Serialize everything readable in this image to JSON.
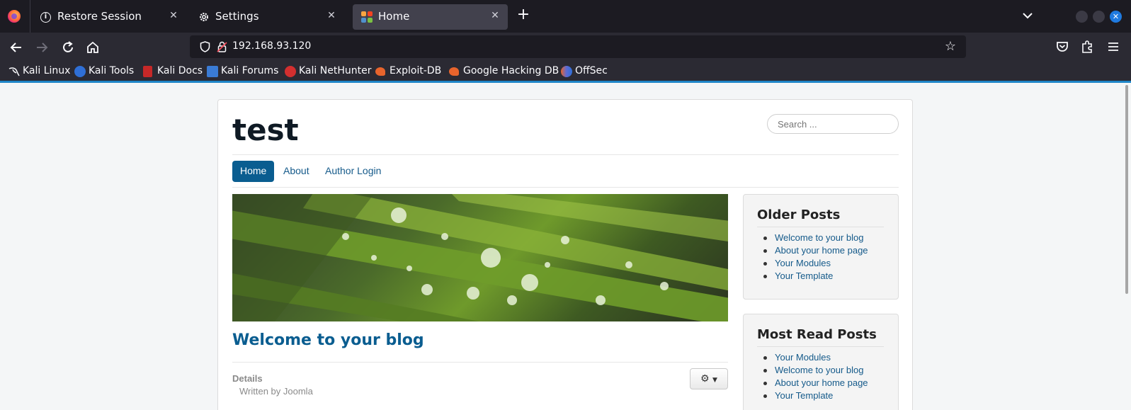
{
  "browser": {
    "tabs": [
      {
        "title": "Restore Session",
        "icon": "info-icon",
        "active": false
      },
      {
        "title": "Settings",
        "icon": "gear-icon",
        "active": false
      },
      {
        "title": "Home",
        "icon": "joomla-icon",
        "active": true
      }
    ],
    "new_tab_glyph": "+",
    "close_glyph": "✕",
    "url": "192.168.93.120",
    "bookmarks": [
      {
        "label": "Kali Linux",
        "icon": "kali-dragon-icon",
        "color": "#1c1b22"
      },
      {
        "label": "Kali Tools",
        "icon": "kali-tools-icon",
        "color": "#2f6fd6"
      },
      {
        "label": "Kali Docs",
        "icon": "kali-docs-icon",
        "color": "#c62828"
      },
      {
        "label": "Kali Forums",
        "icon": "kali-forums-icon",
        "color": "#3a7bd5"
      },
      {
        "label": "Kali NetHunter",
        "icon": "nethunter-icon",
        "color": "#d32f2f"
      },
      {
        "label": "Exploit-DB",
        "icon": "exploit-db-icon",
        "color": "#e8642c"
      },
      {
        "label": "Google Hacking DB",
        "icon": "ghdb-icon",
        "color": "#e8642c"
      },
      {
        "label": "OffSec",
        "icon": "offsec-icon",
        "color": "#5b6bd6"
      }
    ]
  },
  "site": {
    "title": "test",
    "search_placeholder": "Search ...",
    "menu": [
      {
        "label": "Home",
        "active": true
      },
      {
        "label": "About",
        "active": false
      },
      {
        "label": "Author Login",
        "active": false
      }
    ],
    "post": {
      "title": "Welcome to your blog",
      "details_label": "Details",
      "written_by": "Written by Joomla"
    },
    "modules": [
      {
        "title": "Older Posts",
        "items": [
          "Welcome to your blog",
          "About your home page",
          "Your Modules",
          "Your Template"
        ]
      },
      {
        "title": "Most Read Posts",
        "items": [
          "Your Modules",
          "Welcome to your blog",
          "About your home page",
          "Your Template"
        ]
      }
    ]
  },
  "colors": {
    "accent": "#0a5d90",
    "link": "#155a8a",
    "chrome_dark": "#1c1b22",
    "chrome": "#2b2a33"
  }
}
